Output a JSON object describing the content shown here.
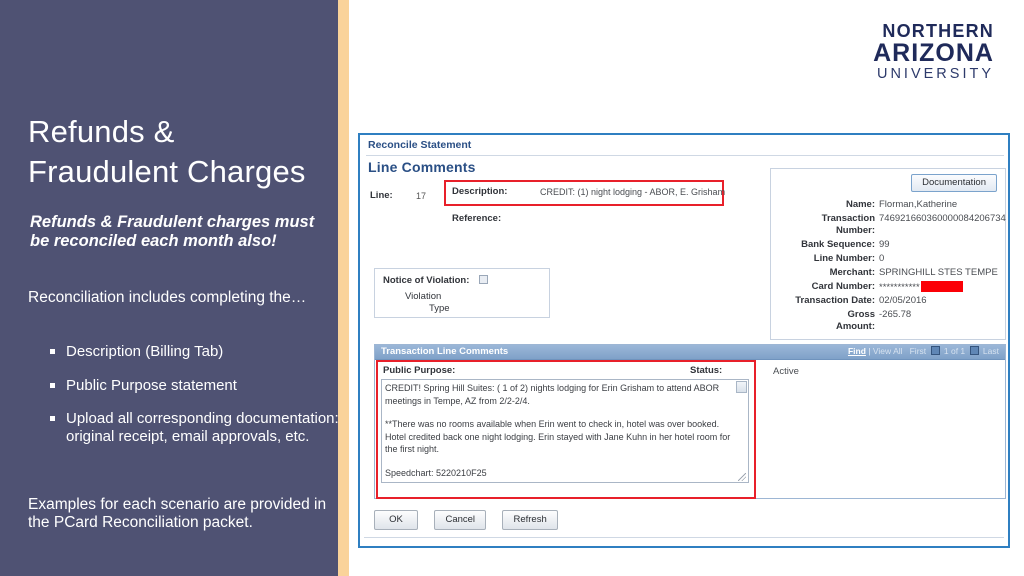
{
  "slide": {
    "title": "Refunds &\nFraudulent Charges",
    "lead": "Refunds & Fraudulent charges must be reconciled each month also!",
    "body": "Reconciliation includes completing the…",
    "bullets": [
      "Description (Billing Tab)",
      "Public Purpose statement",
      "Upload all corresponding documentation: original receipt, email approvals, etc."
    ],
    "closing": "Examples for each scenario are provided in the PCard Reconciliation packet.",
    "accent_color": "#fad39a",
    "panel_color": "#4f5273"
  },
  "logo": {
    "line1": "NORTHERN",
    "line2": "ARIZONA",
    "line3": "UNIVERSITY",
    "color": "#1f2a5a"
  },
  "screenshot": {
    "breadcrumb": "Reconcile Statement",
    "heading": "Line Comments",
    "line_label": "Line:",
    "line_value": "17",
    "description_label": "Description:",
    "description_value": "CREDIT: (1) night lodging - ABOR, E. Grisham",
    "reference_label": "Reference:",
    "highlight_color": "#e8202a",
    "violation": {
      "label": "Notice of Violation:",
      "sub_line1": "Violation",
      "sub_line2": "Type"
    },
    "info_card": {
      "documentation_button": "Documentation",
      "rows": [
        {
          "key": "Name:",
          "value": "Florman,Katherine"
        },
        {
          "key": "Transaction Number:",
          "value": "746921660360000084206734"
        },
        {
          "key": "Bank Sequence:",
          "value": "99"
        },
        {
          "key": "Line Number:",
          "value": "0"
        },
        {
          "key": "Merchant:",
          "value": "SPRINGHILL STES TEMPE"
        },
        {
          "key": "Card Number:",
          "value": "***********"
        },
        {
          "key": "Transaction Date:",
          "value": "02/05/2016"
        },
        {
          "key": "Gross Amount:",
          "value": "-265.78"
        }
      ]
    },
    "comments": {
      "group_title": "Transaction Line Comments",
      "nav": {
        "find": "Find",
        "separator": "|",
        "view_all": "View All",
        "first": "First",
        "counter": "1 of 1",
        "last": "Last"
      },
      "public_purpose_label": "Public Purpose:",
      "status_label": "Status:",
      "status_value": "Active",
      "public_purpose_paragraphs": [
        "CREDIT! Spring Hill Suites: ( 1 of 2) nights lodging for Erin Grisham to attend ABOR meetings in Tempe, AZ from 2/2-2/4.",
        "**There was no rooms available when Erin went to check in, hotel was over booked. Hotel credited back one night lodging. Erin stayed with Jane Kuhn in her hotel room for the first night.",
        "Speedchart: 5220210F25"
      ]
    },
    "buttons": [
      "OK",
      "Cancel",
      "Refresh"
    ]
  }
}
